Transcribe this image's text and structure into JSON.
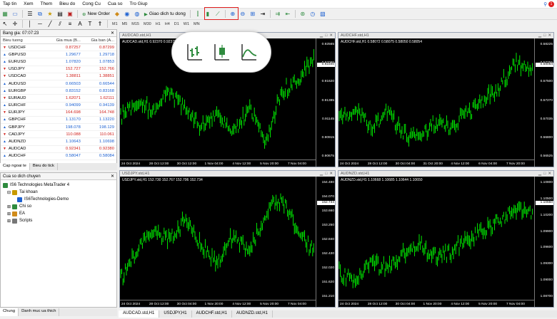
{
  "menu": [
    "Tap tin",
    "Xem",
    "Them",
    "Bieu do",
    "Cong Cu",
    "Cua so",
    "Tro Giup"
  ],
  "toolbar": {
    "new_order": "New Order",
    "auto_trading": "Giao dich tu dong"
  },
  "timeframes": [
    "M1",
    "M5",
    "M15",
    "M30",
    "H1",
    "H4",
    "D1",
    "W1",
    "MN"
  ],
  "market_watch": {
    "title": "Bang gia: 07:07:23",
    "col_symbol": "Bieu tuong",
    "col_bid": "Gia mua (B...",
    "col_ask": "Gia ban (A...",
    "rows": [
      {
        "symbol": "USDCHF",
        "bid": "0.87257",
        "ask": "0.87299",
        "dir": "dn"
      },
      {
        "symbol": "GBPUSD",
        "bid": "1.29677",
        "ask": "1.29718",
        "dir": "up"
      },
      {
        "symbol": "EURUSD",
        "bid": "1.07820",
        "ask": "1.07853",
        "dir": "up"
      },
      {
        "symbol": "USDJPY",
        "bid": "152.727",
        "ask": "152.766",
        "dir": "dn"
      },
      {
        "symbol": "USDCAD",
        "bid": "1.38811",
        "ask": "1.38851",
        "dir": "dn"
      },
      {
        "symbol": "AUDUSD",
        "bid": "0.66503",
        "ask": "0.66544",
        "dir": "up"
      },
      {
        "symbol": "EURGBP",
        "bid": "0.83152",
        "ask": "0.83168",
        "dir": "up"
      },
      {
        "symbol": "EURAUD",
        "bid": "1.62071",
        "ask": "1.62111",
        "dir": "dn"
      },
      {
        "symbol": "EURCHF",
        "bid": "0.94099",
        "ask": "0.94139",
        "dir": "up"
      },
      {
        "symbol": "EURJPY",
        "bid": "164.698",
        "ask": "164.748",
        "dir": "dn"
      },
      {
        "symbol": "GBPCHF",
        "bid": "1.13170",
        "ask": "1.13220",
        "dir": "up"
      },
      {
        "symbol": "GBPJPY",
        "bid": "198.078",
        "ask": "198.129",
        "dir": "up"
      },
      {
        "symbol": "CADJPY",
        "bid": "110.088",
        "ask": "110.061",
        "dir": "dn"
      },
      {
        "symbol": "AUDNZD",
        "bid": "1.10643",
        "ask": "1.10698",
        "dir": "up"
      },
      {
        "symbol": "AUDCAD",
        "bid": "0.92341",
        "ask": "0.92380",
        "dir": "dn"
      },
      {
        "symbol": "AUDCHF",
        "bid": "0.58047",
        "ask": "0.58084",
        "dir": "up"
      }
    ],
    "tabs": [
      "Cap ngoai te",
      "Bieu do tick"
    ]
  },
  "navigator": {
    "title": "Cua so dich chuyen",
    "items": [
      "IS6 Technologies MetaTrader 4",
      "Tai khoan",
      "IS6Technologies-Demo",
      "Chi so",
      "EA",
      "Scripts"
    ],
    "tabs": [
      "Chung",
      "Danh muc ua thich"
    ]
  },
  "charts": [
    {
      "title": "AUDCAD.std,H1",
      "info": "AUDCAD.std,H1  0.92370 0.92375 0.92331 0.92340",
      "price": "0.92340",
      "y": [
        "0.92565",
        "0.92095",
        "0.91620",
        "0.91385",
        "0.91145",
        "0.90915",
        "0.90675"
      ],
      "x": [
        "24 Oct 2024",
        "28 Oct 12:00",
        "30 Oct 12:00",
        "1 Nov 04:00",
        "4 Nov 12:00",
        "5 Nov 20:00",
        "7 Nov 04:00"
      ]
    },
    {
      "title": "AUDCHF.std,H1",
      "info": "AUDCHF.std,H1  0.58072 0.58075 0.58050 0.58054",
      "price": "0.58054",
      "y": [
        "0.58225",
        "0.57755",
        "0.57500",
        "0.57270",
        "0.57035",
        "0.56800",
        "0.56525"
      ],
      "x": [
        "24 Oct 2024",
        "28 Oct 12:00",
        "30 Oct 04:00",
        "31 Oct 20:00",
        "4 Nov 12:00",
        "6 Nov 04:00",
        "7 Nov 20:00"
      ]
    },
    {
      "title": "USDJPY.std,H1",
      "info": "USDJPY.std,H1  152.730 152.767 152.706 152.734",
      "price": "152.734",
      "y": [
        "154.480",
        "154.070",
        "153.660",
        "153.250",
        "152.840",
        "152.430",
        "152.020",
        "151.620",
        "151.210"
      ],
      "x": [
        "24 Oct 2024",
        "28 Oct 12:00",
        "30 Oct 04:00",
        "1 Nov 20:00",
        "4 Nov 12:00",
        "5 Nov 20:00",
        "7 Nov 04:00"
      ]
    },
    {
      "title": "AUDNZD.std,H1",
      "info": "AUDNZD.std,H1  1.10668 1.10685 1.10644 1.10650",
      "price": "1.10650",
      "y": [
        "1.10800",
        "1.10500",
        "1.10200",
        "1.09900",
        "1.09600",
        "1.09300",
        "1.09000",
        "1.08700"
      ],
      "x": [
        "24 Oct 2024",
        "28 Oct 12:00",
        "30 Oct 04:00",
        "1 Nov 20:00",
        "4 Nov 12:00",
        "5 Nov 20:00",
        "7 Nov 04:00"
      ]
    }
  ],
  "chart_tabs": [
    "AUDCAD.std,H1",
    "USDJPY,H1",
    "AUDCHF.std,H1",
    "AUDNZD.std,H1"
  ],
  "colors": {
    "candle": "#00ff00",
    "chart_bg": "#000000",
    "highlight": "#e01e1e"
  }
}
